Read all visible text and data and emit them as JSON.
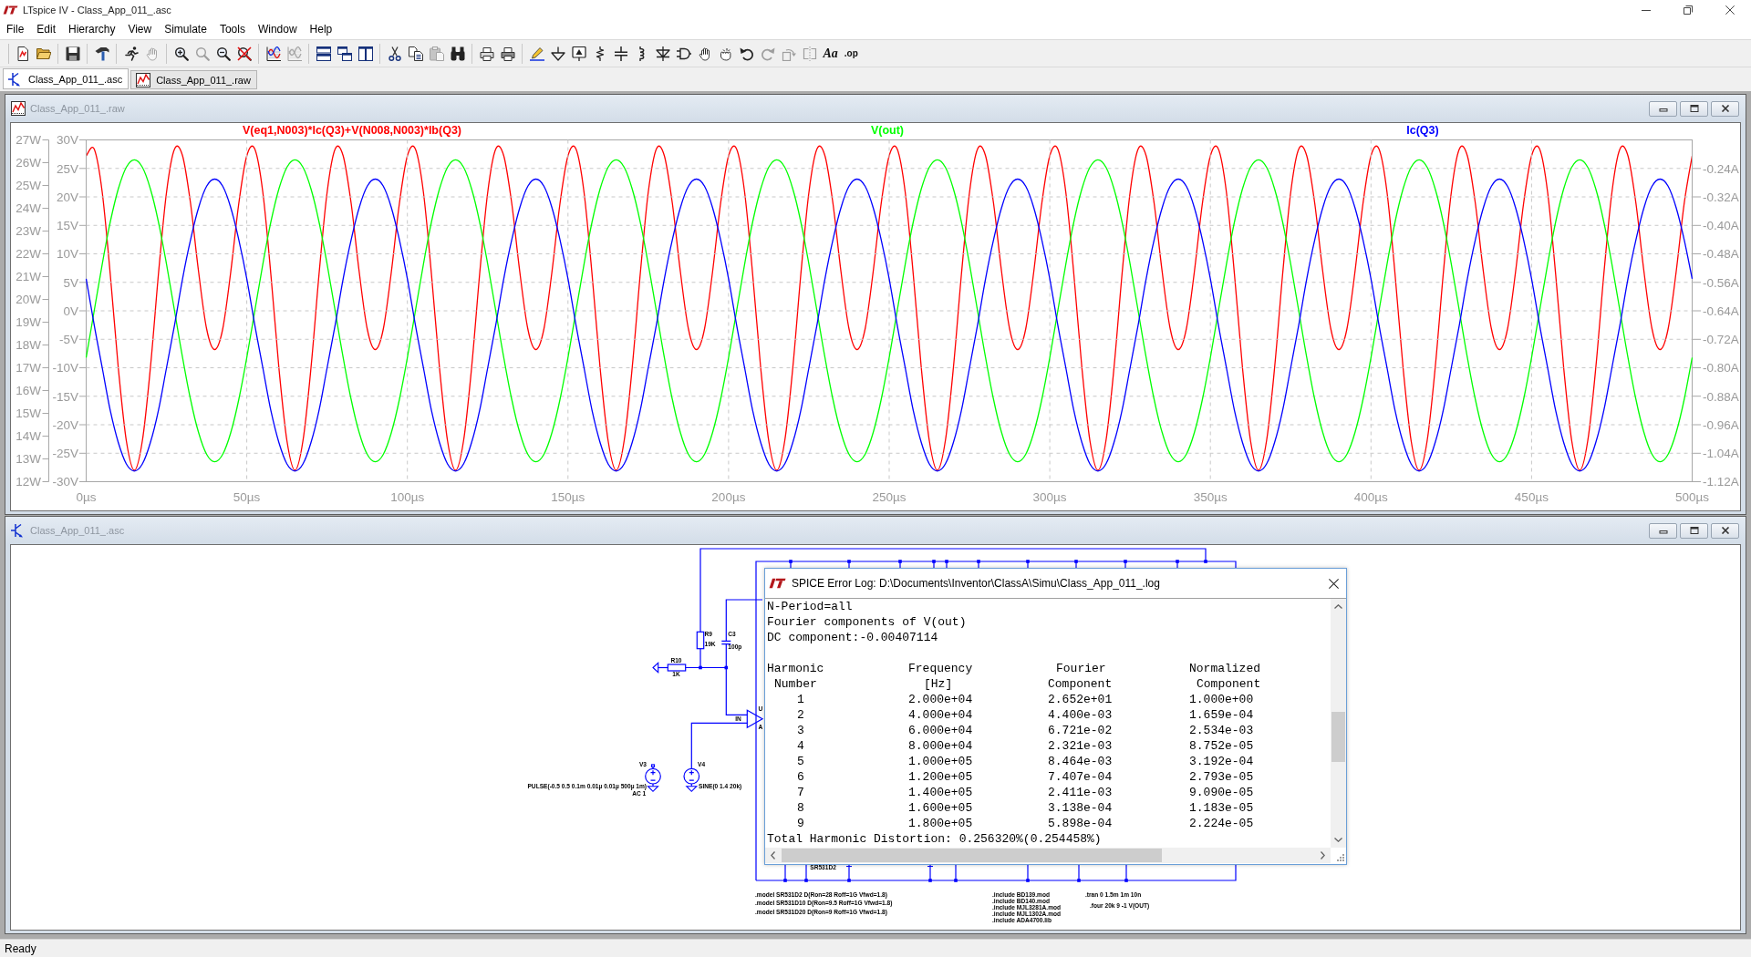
{
  "window": {
    "title": "LTspice IV - Class_App_011_.asc"
  },
  "menu": [
    "File",
    "Edit",
    "Hierarchy",
    "View",
    "Simulate",
    "Tools",
    "Window",
    "Help"
  ],
  "toolbar": [
    {
      "buttons": [
        {
          "kind": "new",
          "disabled": false
        },
        {
          "kind": "open",
          "disabled": false
        }
      ]
    },
    {
      "buttons": [
        {
          "kind": "save",
          "disabled": false
        }
      ]
    },
    {
      "buttons": [
        {
          "kind": "setup",
          "disabled": false
        }
      ]
    },
    {
      "buttons": [
        {
          "kind": "run",
          "disabled": false
        },
        {
          "kind": "halt",
          "disabled": true
        }
      ]
    },
    {
      "buttons": [
        {
          "kind": "zoomin",
          "disabled": false
        },
        {
          "kind": "pan",
          "disabled": true
        },
        {
          "kind": "zoomout",
          "disabled": false
        },
        {
          "kind": "zoomfit",
          "disabled": false
        }
      ]
    },
    {
      "buttons": [
        {
          "kind": "autoscale",
          "disabled": false
        },
        {
          "kind": "annotate",
          "disabled": true
        }
      ]
    },
    {
      "buttons": [
        {
          "kind": "tilehoriz",
          "disabled": false
        },
        {
          "kind": "cascade",
          "disabled": false
        },
        {
          "kind": "tilevert",
          "disabled": false
        }
      ]
    },
    {
      "buttons": [
        {
          "kind": "cut",
          "disabled": false
        },
        {
          "kind": "copy",
          "disabled": false
        },
        {
          "kind": "paste",
          "disabled": true
        },
        {
          "kind": "find",
          "disabled": false
        }
      ]
    },
    {
      "buttons": [
        {
          "kind": "printsetup",
          "disabled": false
        },
        {
          "kind": "print",
          "disabled": false
        }
      ]
    },
    {
      "buttons": [
        {
          "kind": "wire",
          "disabled": false
        },
        {
          "kind": "ground",
          "disabled": false
        },
        {
          "kind": "label",
          "disabled": false
        },
        {
          "kind": "resistor",
          "disabled": false
        },
        {
          "kind": "capacitor",
          "disabled": false
        },
        {
          "kind": "inductor",
          "disabled": false
        },
        {
          "kind": "diode",
          "disabled": false
        },
        {
          "kind": "component",
          "disabled": false
        },
        {
          "kind": "move",
          "disabled": false
        },
        {
          "kind": "drag",
          "disabled": false
        },
        {
          "kind": "undo",
          "disabled": false
        },
        {
          "kind": "redo",
          "disabled": true
        },
        {
          "kind": "rotate",
          "disabled": true
        },
        {
          "kind": "mirror",
          "disabled": true
        },
        {
          "kind": "text",
          "label": "Aa",
          "disabled": false
        },
        {
          "kind": "directive",
          "label": ".op",
          "disabled": false
        }
      ]
    }
  ],
  "tabs": [
    {
      "label": "Class_App_011_.asc",
      "kind": "schematic",
      "selected": true
    },
    {
      "label": "Class_App_011_.raw",
      "kind": "waveform",
      "selected": false
    }
  ],
  "waveform_window": {
    "title": "Class_App_011_.raw",
    "active": false,
    "traces": [
      {
        "chart_data": {
          "type": "line",
          "xlim": [
            0,
            500
          ],
          "ylim": [
            12,
            27
          ],
          "yticks": [
            {
              "value": 27,
              "label": "27W"
            },
            {
              "value": 26,
              "label": "26W"
            },
            {
              "value": 25,
              "label": "25W"
            },
            {
              "value": 24,
              "label": "24W"
            },
            {
              "value": 23,
              "label": "23W"
            },
            {
              "value": 22,
              "label": "22W"
            },
            {
              "value": 21,
              "label": "21W"
            },
            {
              "value": 20,
              "label": "20W"
            },
            {
              "value": 19,
              "label": "19W"
            },
            {
              "value": 18,
              "label": "18W"
            },
            {
              "value": 17,
              "label": "17W"
            },
            {
              "value": 16,
              "label": "16W"
            },
            {
              "value": 15,
              "label": "15W"
            },
            {
              "value": 14,
              "label": "14W"
            },
            {
              "value": 13,
              "label": "13W"
            },
            {
              "value": 12,
              "label": "12W"
            }
          ],
          "x": [
            0,
            2.5,
            5,
            7.5,
            10,
            12.5,
            15,
            17.5,
            20,
            22.5,
            25,
            27.5,
            30,
            32.5,
            35,
            37.5,
            40,
            42.5,
            45,
            47.5,
            50,
            52.5,
            55,
            57.5,
            60,
            62.5,
            65,
            67.5,
            70,
            72.5,
            75,
            77.5,
            80,
            82.5,
            85,
            87.5,
            90,
            92.5,
            95,
            97.5,
            100,
            102.5,
            105,
            107.5,
            110,
            112.5,
            115,
            117.5,
            120,
            122.5,
            125,
            127.5,
            130,
            132.5,
            135,
            137.5,
            140,
            142.5,
            145,
            147.5,
            150,
            152.5,
            155,
            157.5,
            160,
            162.5,
            165,
            167.5,
            170,
            172.5,
            175,
            177.5,
            180,
            182.5,
            185,
            187.5,
            190,
            192.5,
            195,
            197.5,
            200,
            202.5,
            205,
            207.5,
            210,
            212.5,
            215,
            217.5,
            220,
            222.5,
            225,
            227.5,
            230,
            232.5,
            235,
            237.5,
            240,
            242.5,
            245,
            247.5,
            250,
            252.5,
            255,
            257.5,
            260,
            262.5,
            265,
            267.5,
            270,
            272.5,
            275,
            277.5,
            280,
            282.5,
            285,
            287.5,
            290,
            292.5,
            295,
            297.5,
            300,
            302.5,
            305,
            307.5,
            310,
            312.5,
            315,
            317.5,
            320,
            322.5,
            325,
            327.5,
            330,
            332.5,
            335,
            337.5,
            340,
            342.5,
            345,
            347.5,
            350,
            352.5,
            355,
            357.5,
            360,
            362.5,
            365,
            367.5,
            370,
            372.5,
            375,
            377.5,
            380,
            382.5,
            385,
            387.5,
            390,
            392.5,
            395,
            397.5,
            400,
            402.5,
            405,
            407.5,
            410,
            412.5,
            415,
            417.5,
            420,
            422.5,
            425,
            427.5,
            430,
            432.5,
            435,
            437.5,
            440,
            442.5,
            445,
            447.5,
            450,
            452.5,
            455,
            457.5,
            460,
            462.5,
            465,
            467.5,
            470,
            472.5,
            475,
            477.5,
            480,
            482.5,
            485,
            487.5,
            490,
            492.5,
            495,
            497.5,
            500
          ],
          "series": [
            {
              "name": "V(eq1,N003)*Ic(Q3)+V(N008,N003)*Ib(Q3)",
              "color": "#ff0000",
              "values": [
                26.3,
                26.6,
                24.7,
                21.1,
                17,
                13.8,
                12.5,
                13.8,
                17,
                21.1,
                24.7,
                26.6,
                26.3,
                24.2,
                21.2,
                18.7,
                17.8,
                18.7,
                21.2,
                24.2,
                26.3,
                26.6,
                24.7,
                21.1,
                17,
                13.8,
                12.5,
                13.8,
                17,
                21.1,
                24.7,
                26.6,
                26.3,
                24.2,
                21.2,
                18.7,
                17.8,
                18.7,
                21.2,
                24.2,
                26.3,
                26.6,
                24.7,
                21.1,
                17,
                13.8,
                12.5,
                13.8,
                17,
                21.1,
                24.7,
                26.6,
                26.3,
                24.2,
                21.2,
                18.7,
                17.8,
                18.7,
                21.2,
                24.2,
                26.3,
                26.6,
                24.7,
                21.1,
                17,
                13.8,
                12.5,
                13.8,
                17,
                21.1,
                24.7,
                26.6,
                26.3,
                24.2,
                21.2,
                18.7,
                17.8,
                18.7,
                21.2,
                24.2,
                26.3,
                26.6,
                24.7,
                21.1,
                17,
                13.8,
                12.5,
                13.8,
                17,
                21.1,
                24.7,
                26.6,
                26.3,
                24.2,
                21.2,
                18.7,
                17.8,
                18.7,
                21.2,
                24.2,
                26.3,
                26.6,
                24.7,
                21.1,
                17,
                13.8,
                12.5,
                13.8,
                17,
                21.1,
                24.7,
                26.6,
                26.3,
                24.2,
                21.2,
                18.7,
                17.8,
                18.7,
                21.2,
                24.2,
                26.3,
                26.6,
                24.7,
                21.1,
                17,
                13.8,
                12.5,
                13.8,
                17,
                21.1,
                24.7,
                26.6,
                26.3,
                24.2,
                21.2,
                18.7,
                17.8,
                18.7,
                21.2,
                24.2,
                26.3,
                26.6,
                24.7,
                21.1,
                17,
                13.8,
                12.5,
                13.8,
                17,
                21.1,
                24.7,
                26.6,
                26.3,
                24.2,
                21.2,
                18.7,
                17.8,
                18.7,
                21.2,
                24.2,
                26.3,
                26.6,
                24.7,
                21.1,
                17,
                13.8,
                12.5,
                13.8,
                17,
                21.1,
                24.7,
                26.6,
                26.3,
                24.2,
                21.2,
                18.7,
                17.8,
                18.7,
                21.2,
                24.2,
                26.3,
                26.6,
                24.7,
                21.1,
                17,
                13.8,
                12.5,
                13.8,
                17,
                21.1,
                24.7,
                26.6,
                26.3,
                24.2,
                21.2,
                18.7,
                17.8,
                18.7,
                21.2,
                24.2,
                26.3
              ]
            }
          ]
        }
      },
      {
        "chart_data": {
          "type": "line",
          "grid": true,
          "xlim": [
            0,
            500
          ],
          "xticks": [
            {
              "value": 0,
              "label": "0µs"
            },
            {
              "value": 50,
              "label": "50µs"
            },
            {
              "value": 100,
              "label": "100µs"
            },
            {
              "value": 150,
              "label": "150µs"
            },
            {
              "value": 200,
              "label": "200µs"
            },
            {
              "value": 250,
              "label": "250µs"
            },
            {
              "value": 300,
              "label": "300µs"
            },
            {
              "value": 350,
              "label": "350µs"
            },
            {
              "value": 400,
              "label": "400µs"
            },
            {
              "value": 450,
              "label": "450µs"
            },
            {
              "value": 500,
              "label": "500µs"
            }
          ],
          "ylim": [
            -30,
            30
          ],
          "yticks": [
            {
              "value": 30,
              "label": "30V"
            },
            {
              "value": 25,
              "label": "25V"
            },
            {
              "value": 20,
              "label": "20V"
            },
            {
              "value": 15,
              "label": "15V"
            },
            {
              "value": 10,
              "label": "10V"
            },
            {
              "value": 5,
              "label": "5V"
            },
            {
              "value": 0,
              "label": "0V"
            },
            {
              "value": -5,
              "label": "-5V"
            },
            {
              "value": -10,
              "label": "-10V"
            },
            {
              "value": -15,
              "label": "-15V"
            },
            {
              "value": -20,
              "label": "-20V"
            },
            {
              "value": -25,
              "label": "-25V"
            },
            {
              "value": -30,
              "label": "-30V"
            }
          ],
          "x": [
            0,
            2.5,
            5,
            7.5,
            10,
            12.5,
            15,
            17.5,
            20,
            22.5,
            25,
            27.5,
            30,
            32.5,
            35,
            37.5,
            40,
            42.5,
            45,
            47.5,
            50,
            52.5,
            55,
            57.5,
            60,
            62.5,
            65,
            67.5,
            70,
            72.5,
            75,
            77.5,
            80,
            82.5,
            85,
            87.5,
            90,
            92.5,
            95,
            97.5,
            100,
            102.5,
            105,
            107.5,
            110,
            112.5,
            115,
            117.5,
            120,
            122.5,
            125,
            127.5,
            130,
            132.5,
            135,
            137.5,
            140,
            142.5,
            145,
            147.5,
            150,
            152.5,
            155,
            157.5,
            160,
            162.5,
            165,
            167.5,
            170,
            172.5,
            175,
            177.5,
            180,
            182.5,
            185,
            187.5,
            190,
            192.5,
            195,
            197.5,
            200,
            202.5,
            205,
            207.5,
            210,
            212.5,
            215,
            217.5,
            220,
            222.5,
            225,
            227.5,
            230,
            232.5,
            235,
            237.5,
            240,
            242.5,
            245,
            247.5,
            250,
            252.5,
            255,
            257.5,
            260,
            262.5,
            265,
            267.5,
            270,
            272.5,
            275,
            277.5,
            280,
            282.5,
            285,
            287.5,
            290,
            292.5,
            295,
            297.5,
            300,
            302.5,
            305,
            307.5,
            310,
            312.5,
            315,
            317.5,
            320,
            322.5,
            325,
            327.5,
            330,
            332.5,
            335,
            337.5,
            340,
            342.5,
            345,
            347.5,
            350,
            352.5,
            355,
            357.5,
            360,
            362.5,
            365,
            367.5,
            370,
            372.5,
            375,
            377.5,
            380,
            382.5,
            385,
            387.5,
            390,
            392.5,
            395,
            397.5,
            400,
            402.5,
            405,
            407.5,
            410,
            412.5,
            415,
            417.5,
            420,
            422.5,
            425,
            427.5,
            430,
            432.5,
            435,
            437.5,
            440,
            442.5,
            445,
            447.5,
            450,
            452.5,
            455,
            457.5,
            460,
            462.5,
            465,
            467.5,
            470,
            472.5,
            475,
            477.5,
            480,
            482.5,
            485,
            487.5,
            490,
            492.5,
            495,
            497.5,
            500
          ],
          "series": [
            {
              "name": "V(out)",
              "color": "#00ff00",
              "values": [
                -8.2,
                0,
                8.2,
                15.6,
                21.4,
                25.2,
                26.5,
                25.2,
                21.4,
                15.6,
                8.2,
                0,
                -8.2,
                -15.6,
                -21.4,
                -25.2,
                -26.5,
                -25.2,
                -21.4,
                -15.6,
                -8.2,
                0,
                8.2,
                15.6,
                21.4,
                25.2,
                26.5,
                25.2,
                21.4,
                15.6,
                8.2,
                0,
                -8.2,
                -15.6,
                -21.4,
                -25.2,
                -26.5,
                -25.2,
                -21.4,
                -15.6,
                -8.2,
                0,
                8.2,
                15.6,
                21.4,
                25.2,
                26.5,
                25.2,
                21.4,
                15.6,
                8.2,
                0,
                -8.2,
                -15.6,
                -21.4,
                -25.2,
                -26.5,
                -25.2,
                -21.4,
                -15.6,
                -8.2,
                0,
                8.2,
                15.6,
                21.4,
                25.2,
                26.5,
                25.2,
                21.4,
                15.6,
                8.2,
                0,
                -8.2,
                -15.6,
                -21.4,
                -25.2,
                -26.5,
                -25.2,
                -21.4,
                -15.6,
                -8.2,
                0,
                8.2,
                15.6,
                21.4,
                25.2,
                26.5,
                25.2,
                21.4,
                15.6,
                8.2,
                0,
                -8.2,
                -15.6,
                -21.4,
                -25.2,
                -26.5,
                -25.2,
                -21.4,
                -15.6,
                -8.2,
                0,
                8.2,
                15.6,
                21.4,
                25.2,
                26.5,
                25.2,
                21.4,
                15.6,
                8.2,
                0,
                -8.2,
                -15.6,
                -21.4,
                -25.2,
                -26.5,
                -25.2,
                -21.4,
                -15.6,
                -8.2,
                0,
                8.2,
                15.6,
                21.4,
                25.2,
                26.5,
                25.2,
                21.4,
                15.6,
                8.2,
                0,
                -8.2,
                -15.6,
                -21.4,
                -25.2,
                -26.5,
                -25.2,
                -21.4,
                -15.6,
                -8.2,
                0,
                8.2,
                15.6,
                21.4,
                25.2,
                26.5,
                25.2,
                21.4,
                15.6,
                8.2,
                0,
                -8.2,
                -15.6,
                -21.4,
                -25.2,
                -26.5,
                -25.2,
                -21.4,
                -15.6,
                -8.2,
                0,
                8.2,
                15.6,
                21.4,
                25.2,
                26.5,
                25.2,
                21.4,
                15.6,
                8.2,
                0,
                -8.2,
                -15.6,
                -21.4,
                -25.2,
                -26.5,
                -25.2,
                -21.4,
                -15.6,
                -8.2,
                0,
                8.2,
                15.6,
                21.4,
                25.2,
                26.5,
                25.2,
                21.4,
                15.6,
                8.2,
                0,
                -8.2,
                -15.6,
                -21.4,
                -25.2,
                -26.5,
                -25.2,
                -21.4,
                -15.6,
                -8.2
              ]
            }
          ]
        }
      },
      {
        "chart_data": {
          "type": "line",
          "xlim": [
            0,
            500
          ],
          "ylim": [
            -1.12,
            -0.16
          ],
          "yticks": [
            {
              "value": -0.24,
              "label": "-0.24A"
            },
            {
              "value": -0.32,
              "label": "-0.32A"
            },
            {
              "value": -0.4,
              "label": "-0.40A"
            },
            {
              "value": -0.48,
              "label": "-0.48A"
            },
            {
              "value": -0.56,
              "label": "-0.56A"
            },
            {
              "value": -0.64,
              "label": "-0.64A"
            },
            {
              "value": -0.72,
              "label": "-0.72A"
            },
            {
              "value": -0.8,
              "label": "-0.80A"
            },
            {
              "value": -0.88,
              "label": "-0.88A"
            },
            {
              "value": -0.96,
              "label": "-0.96A"
            },
            {
              "value": -1.04,
              "label": "-1.04A"
            },
            {
              "value": -1.12,
              "label": "-1.12A"
            }
          ],
          "x": [
            0,
            2.5,
            5,
            7.5,
            10,
            12.5,
            15,
            17.5,
            20,
            22.5,
            25,
            27.5,
            30,
            32.5,
            35,
            37.5,
            40,
            42.5,
            45,
            47.5,
            50,
            52.5,
            55,
            57.5,
            60,
            62.5,
            65,
            67.5,
            70,
            72.5,
            75,
            77.5,
            80,
            82.5,
            85,
            87.5,
            90,
            92.5,
            95,
            97.5,
            100,
            102.5,
            105,
            107.5,
            110,
            112.5,
            115,
            117.5,
            120,
            122.5,
            125,
            127.5,
            130,
            132.5,
            135,
            137.5,
            140,
            142.5,
            145,
            147.5,
            150,
            152.5,
            155,
            157.5,
            160,
            162.5,
            165,
            167.5,
            170,
            172.5,
            175,
            177.5,
            180,
            182.5,
            185,
            187.5,
            190,
            192.5,
            195,
            197.5,
            200,
            202.5,
            205,
            207.5,
            210,
            212.5,
            215,
            217.5,
            220,
            222.5,
            225,
            227.5,
            230,
            232.5,
            235,
            237.5,
            240,
            242.5,
            245,
            247.5,
            250,
            252.5,
            255,
            257.5,
            260,
            262.5,
            265,
            267.5,
            270,
            272.5,
            275,
            277.5,
            280,
            282.5,
            285,
            287.5,
            290,
            292.5,
            295,
            297.5,
            300,
            302.5,
            305,
            307.5,
            310,
            312.5,
            315,
            317.5,
            320,
            322.5,
            325,
            327.5,
            330,
            332.5,
            335,
            337.5,
            340,
            342.5,
            345,
            347.5,
            350,
            352.5,
            355,
            357.5,
            360,
            362.5,
            365,
            367.5,
            370,
            372.5,
            375,
            377.5,
            380,
            382.5,
            385,
            387.5,
            390,
            392.5,
            395,
            397.5,
            400,
            402.5,
            405,
            407.5,
            410,
            412.5,
            415,
            417.5,
            420,
            422.5,
            425,
            427.5,
            430,
            432.5,
            435,
            437.5,
            440,
            442.5,
            445,
            447.5,
            450,
            452.5,
            455,
            457.5,
            460,
            462.5,
            465,
            467.5,
            470,
            472.5,
            475,
            477.5,
            480,
            482.5,
            485,
            487.5,
            490,
            492.5,
            495,
            497.5,
            500
          ],
          "series": [
            {
              "name": "Ic(Q3)",
              "color": "#0000ff",
              "values": [
                -0.55,
                -0.68,
                -0.8,
                -0.92,
                -1.01,
                -1.07,
                -1.09,
                -1.07,
                -1.01,
                -0.92,
                -0.8,
                -0.68,
                -0.55,
                -0.44,
                -0.35,
                -0.29,
                -0.27,
                -0.29,
                -0.35,
                -0.44,
                -0.55,
                -0.68,
                -0.8,
                -0.92,
                -1.01,
                -1.07,
                -1.09,
                -1.07,
                -1.01,
                -0.92,
                -0.8,
                -0.68,
                -0.55,
                -0.44,
                -0.35,
                -0.29,
                -0.27,
                -0.29,
                -0.35,
                -0.44,
                -0.55,
                -0.68,
                -0.8,
                -0.92,
                -1.01,
                -1.07,
                -1.09,
                -1.07,
                -1.01,
                -0.92,
                -0.8,
                -0.68,
                -0.55,
                -0.44,
                -0.35,
                -0.29,
                -0.27,
                -0.29,
                -0.35,
                -0.44,
                -0.55,
                -0.68,
                -0.8,
                -0.92,
                -1.01,
                -1.07,
                -1.09,
                -1.07,
                -1.01,
                -0.92,
                -0.8,
                -0.68,
                -0.55,
                -0.44,
                -0.35,
                -0.29,
                -0.27,
                -0.29,
                -0.35,
                -0.44,
                -0.55,
                -0.68,
                -0.8,
                -0.92,
                -1.01,
                -1.07,
                -1.09,
                -1.07,
                -1.01,
                -0.92,
                -0.8,
                -0.68,
                -0.55,
                -0.44,
                -0.35,
                -0.29,
                -0.27,
                -0.29,
                -0.35,
                -0.44,
                -0.55,
                -0.68,
                -0.8,
                -0.92,
                -1.01,
                -1.07,
                -1.09,
                -1.07,
                -1.01,
                -0.92,
                -0.8,
                -0.68,
                -0.55,
                -0.44,
                -0.35,
                -0.29,
                -0.27,
                -0.29,
                -0.35,
                -0.44,
                -0.55,
                -0.68,
                -0.8,
                -0.92,
                -1.01,
                -1.07,
                -1.09,
                -1.07,
                -1.01,
                -0.92,
                -0.8,
                -0.68,
                -0.55,
                -0.44,
                -0.35,
                -0.29,
                -0.27,
                -0.29,
                -0.35,
                -0.44,
                -0.55,
                -0.68,
                -0.8,
                -0.92,
                -1.01,
                -1.07,
                -1.09,
                -1.07,
                -1.01,
                -0.92,
                -0.8,
                -0.68,
                -0.55,
                -0.44,
                -0.35,
                -0.29,
                -0.27,
                -0.29,
                -0.35,
                -0.44,
                -0.55,
                -0.68,
                -0.8,
                -0.92,
                -1.01,
                -1.07,
                -1.09,
                -1.07,
                -1.01,
                -0.92,
                -0.8,
                -0.68,
                -0.55,
                -0.44,
                -0.35,
                -0.29,
                -0.27,
                -0.29,
                -0.35,
                -0.44,
                -0.55,
                -0.68,
                -0.8,
                -0.92,
                -1.01,
                -1.07,
                -1.09,
                -1.07,
                -1.01,
                -0.92,
                -0.8,
                -0.68,
                -0.55,
                -0.44,
                -0.35,
                -0.29,
                -0.27,
                -0.29,
                -0.35,
                -0.44,
                -0.55
              ]
            }
          ]
        }
      }
    ]
  },
  "schematic_window": {
    "title": "Class_App_011_.asc",
    "active": false,
    "components": [
      {
        "kind": "resistor",
        "ref": "R9",
        "value": "19K"
      },
      {
        "kind": "capacitor",
        "ref": "C3",
        "value": "100p"
      },
      {
        "kind": "resistor",
        "ref": "R10",
        "value": "1K"
      },
      {
        "kind": "opamp",
        "pins": [
          "U",
          "A"
        ]
      },
      {
        "kind": "source",
        "ref": "V3",
        "value": "PULSE(-0.5 0.5 0.1m 0.01µ 0.01µ 500µ 1m)",
        "value_2": "AC 1"
      },
      {
        "kind": "source",
        "ref": "V4",
        "value": "SINE(0 1.4 20k)"
      }
    ],
    "net_labels": [
      "IN"
    ],
    "part_labels": [
      "SR531D2"
    ],
    "directives": [
      {
        "lines": [
          ".model SR531D2 D(Ron=28 Roff=1G Vfwd=1.8)",
          ".model SR531D10 D(Ron=9.5 Roff=1G Vfwd=1.8)",
          ".model SR531D20 D(Ron=9 Roff=1G Vfwd=1.8)"
        ]
      },
      {
        "lines": [
          ".include BD139.mod",
          ".include BD140.mod",
          ".include MJL3281A.mod",
          ".include MJL1302A.mod",
          ".include ADA4700.lib"
        ]
      },
      {
        "lines": [
          ".tran 0 1.5m 1m 10n"
        ]
      },
      {
        "lines": [
          ".four 20k 9 -1 V(OUT)"
        ]
      }
    ]
  },
  "error_log": {
    "title": "SPICE Error Log: D:\\Documents\\Inventor\\ClassA\\Simu\\Class_App_011_.log",
    "lines": [
      "N-Period=all",
      "Fourier components of V(out)",
      "DC component:-0.00407114"
    ],
    "table": {
      "columns": [
        {
          "line_1": "Harmonic",
          "line_2": "Number"
        },
        {
          "line_1": "Frequency",
          "line_2": "[Hz]"
        },
        {
          "line_1": "Fourier",
          "line_2": "Component"
        },
        {
          "line_1": "Normalized",
          "line_2": "Component"
        }
      ],
      "rows": [
        [
          "1",
          "2.000e+04",
          "2.652e+01",
          "1.000e+00"
        ],
        [
          "2",
          "4.000e+04",
          "4.400e-03",
          "1.659e-04"
        ],
        [
          "3",
          "6.000e+04",
          "6.721e-02",
          "2.534e-03"
        ],
        [
          "4",
          "8.000e+04",
          "2.321e-03",
          "8.752e-05"
        ],
        [
          "5",
          "1.000e+05",
          "8.464e-03",
          "3.192e-04"
        ],
        [
          "6",
          "1.200e+05",
          "7.407e-04",
          "2.793e-05"
        ],
        [
          "7",
          "1.400e+05",
          "2.411e-03",
          "9.090e-05"
        ],
        [
          "8",
          "1.600e+05",
          "3.138e-04",
          "1.183e-05"
        ],
        [
          "9",
          "1.800e+05",
          "5.898e-04",
          "2.224e-05"
        ]
      ]
    },
    "summary": "Total Harmonic Distortion: 0.256320%(0.254458%)"
  },
  "status_bar": "Ready"
}
